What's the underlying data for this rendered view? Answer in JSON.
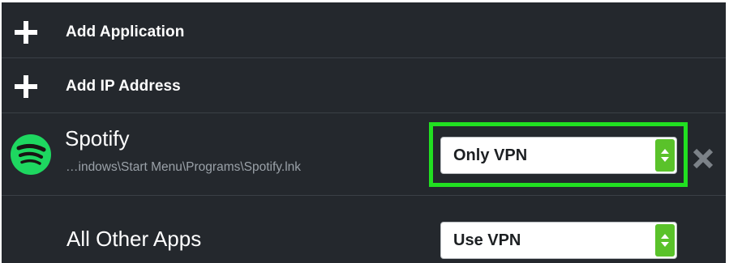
{
  "actions": {
    "add_application": "Add Application",
    "add_ip_address": "Add IP Address"
  },
  "apps": [
    {
      "name": "Spotify",
      "path": "…indows\\Start Menu\\Programs\\Spotify.lnk",
      "icon": "spotify-icon",
      "mode": "Only VPN",
      "highlighted": true
    }
  ],
  "other_apps": {
    "label": "All Other Apps",
    "mode": "Use VPN"
  },
  "colors": {
    "panel_bg": "#24282d",
    "highlight": "#21e021",
    "select_arrow": "#5ac22a",
    "spotify": "#1ed760"
  }
}
